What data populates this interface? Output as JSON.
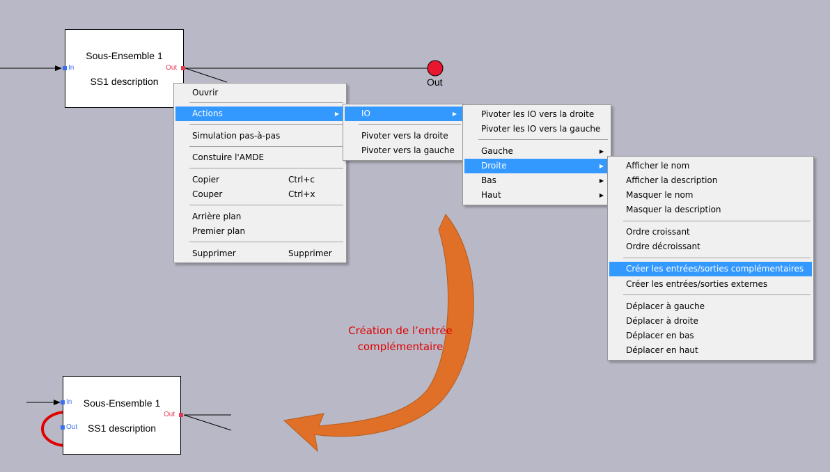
{
  "colors": {
    "canvas": "#b8b8c6",
    "in_port": "#3b6ef2",
    "out_port": "#e23a52",
    "menu_highlight": "#3399ff",
    "arrow_orange": "#e07028",
    "caption_red": "#e00000",
    "annotation_circle": "#e00000"
  },
  "block_top": {
    "title": "Sous-Ensemble 1",
    "description": "SS1 description",
    "in_label": "In",
    "out_label": "Out"
  },
  "block_bottom": {
    "title": "Sous-Ensemble 1",
    "description": "SS1 description",
    "in_label": "In",
    "out_left_label": "Out",
    "out_right_label": "Out"
  },
  "out_terminal": {
    "label": "Out"
  },
  "caption": {
    "line1": "Création de l’entrée",
    "line2": "complémentaire"
  },
  "context_menu": {
    "open": "Ouvrir",
    "actions": "Actions",
    "simulation": "Simulation pas-à-pas",
    "amde": "Constuire l'AMDE",
    "copy": "Copier",
    "copy_shortcut": "Ctrl+c",
    "cut": "Couper",
    "cut_shortcut": "Ctrl+x",
    "send_back": "Arrière plan",
    "bring_front": "Premier plan",
    "delete": "Supprimer",
    "delete_shortcut": "Supprimer"
  },
  "actions_menu": {
    "io": "IO",
    "rotate_right": "Pivoter vers la droite",
    "rotate_left": "Pivoter vers la gauche"
  },
  "io_menu": {
    "rotate_io_right": "Pivoter les IO vers la droite",
    "rotate_io_left": "Pivoter les IO vers la gauche",
    "left": "Gauche",
    "right": "Droite",
    "bottom": "Bas",
    "top": "Haut"
  },
  "droite_menu": {
    "show_name": "Afficher le nom",
    "show_description": "Afficher la description",
    "hide_name": "Masquer le nom",
    "hide_description": "Masquer la description",
    "ascending": "Ordre croissant",
    "descending": "Ordre décroissant",
    "create_complementary": "Créer les entrées/sorties complémentaires",
    "create_external": "Créer les entrées/sorties externes",
    "move_left": "Déplacer à gauche",
    "move_right": "Déplacer à droite",
    "move_down": "Déplacer en bas",
    "move_up": "Déplacer en haut"
  }
}
